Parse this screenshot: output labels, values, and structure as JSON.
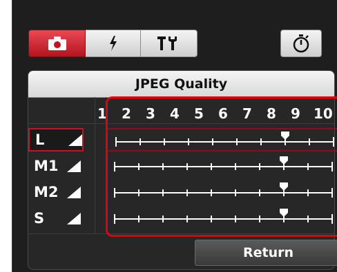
{
  "toolbar": {
    "tabs": [
      {
        "icon": "camera-icon",
        "active": true
      },
      {
        "icon": "flash-icon",
        "active": false
      },
      {
        "icon": "tools-icon",
        "active": false
      }
    ],
    "timer_icon": "timer-icon"
  },
  "panel": {
    "title": "JPEG Quality",
    "scale": [
      "1",
      "2",
      "3",
      "4",
      "5",
      "6",
      "7",
      "8",
      "9",
      "10"
    ],
    "rows": [
      {
        "label": "L",
        "icon": "fine-quality-icon",
        "value": 8,
        "selected": true
      },
      {
        "label": "M1",
        "icon": "fine-quality-icon",
        "value": 8,
        "selected": false
      },
      {
        "label": "M2",
        "icon": "fine-quality-icon",
        "value": 8,
        "selected": false
      },
      {
        "label": "S",
        "icon": "fine-quality-icon",
        "value": 8,
        "selected": false
      }
    ]
  },
  "return_label": "Return",
  "colors": {
    "accent": "#c01522",
    "highlight": "#e00010"
  }
}
